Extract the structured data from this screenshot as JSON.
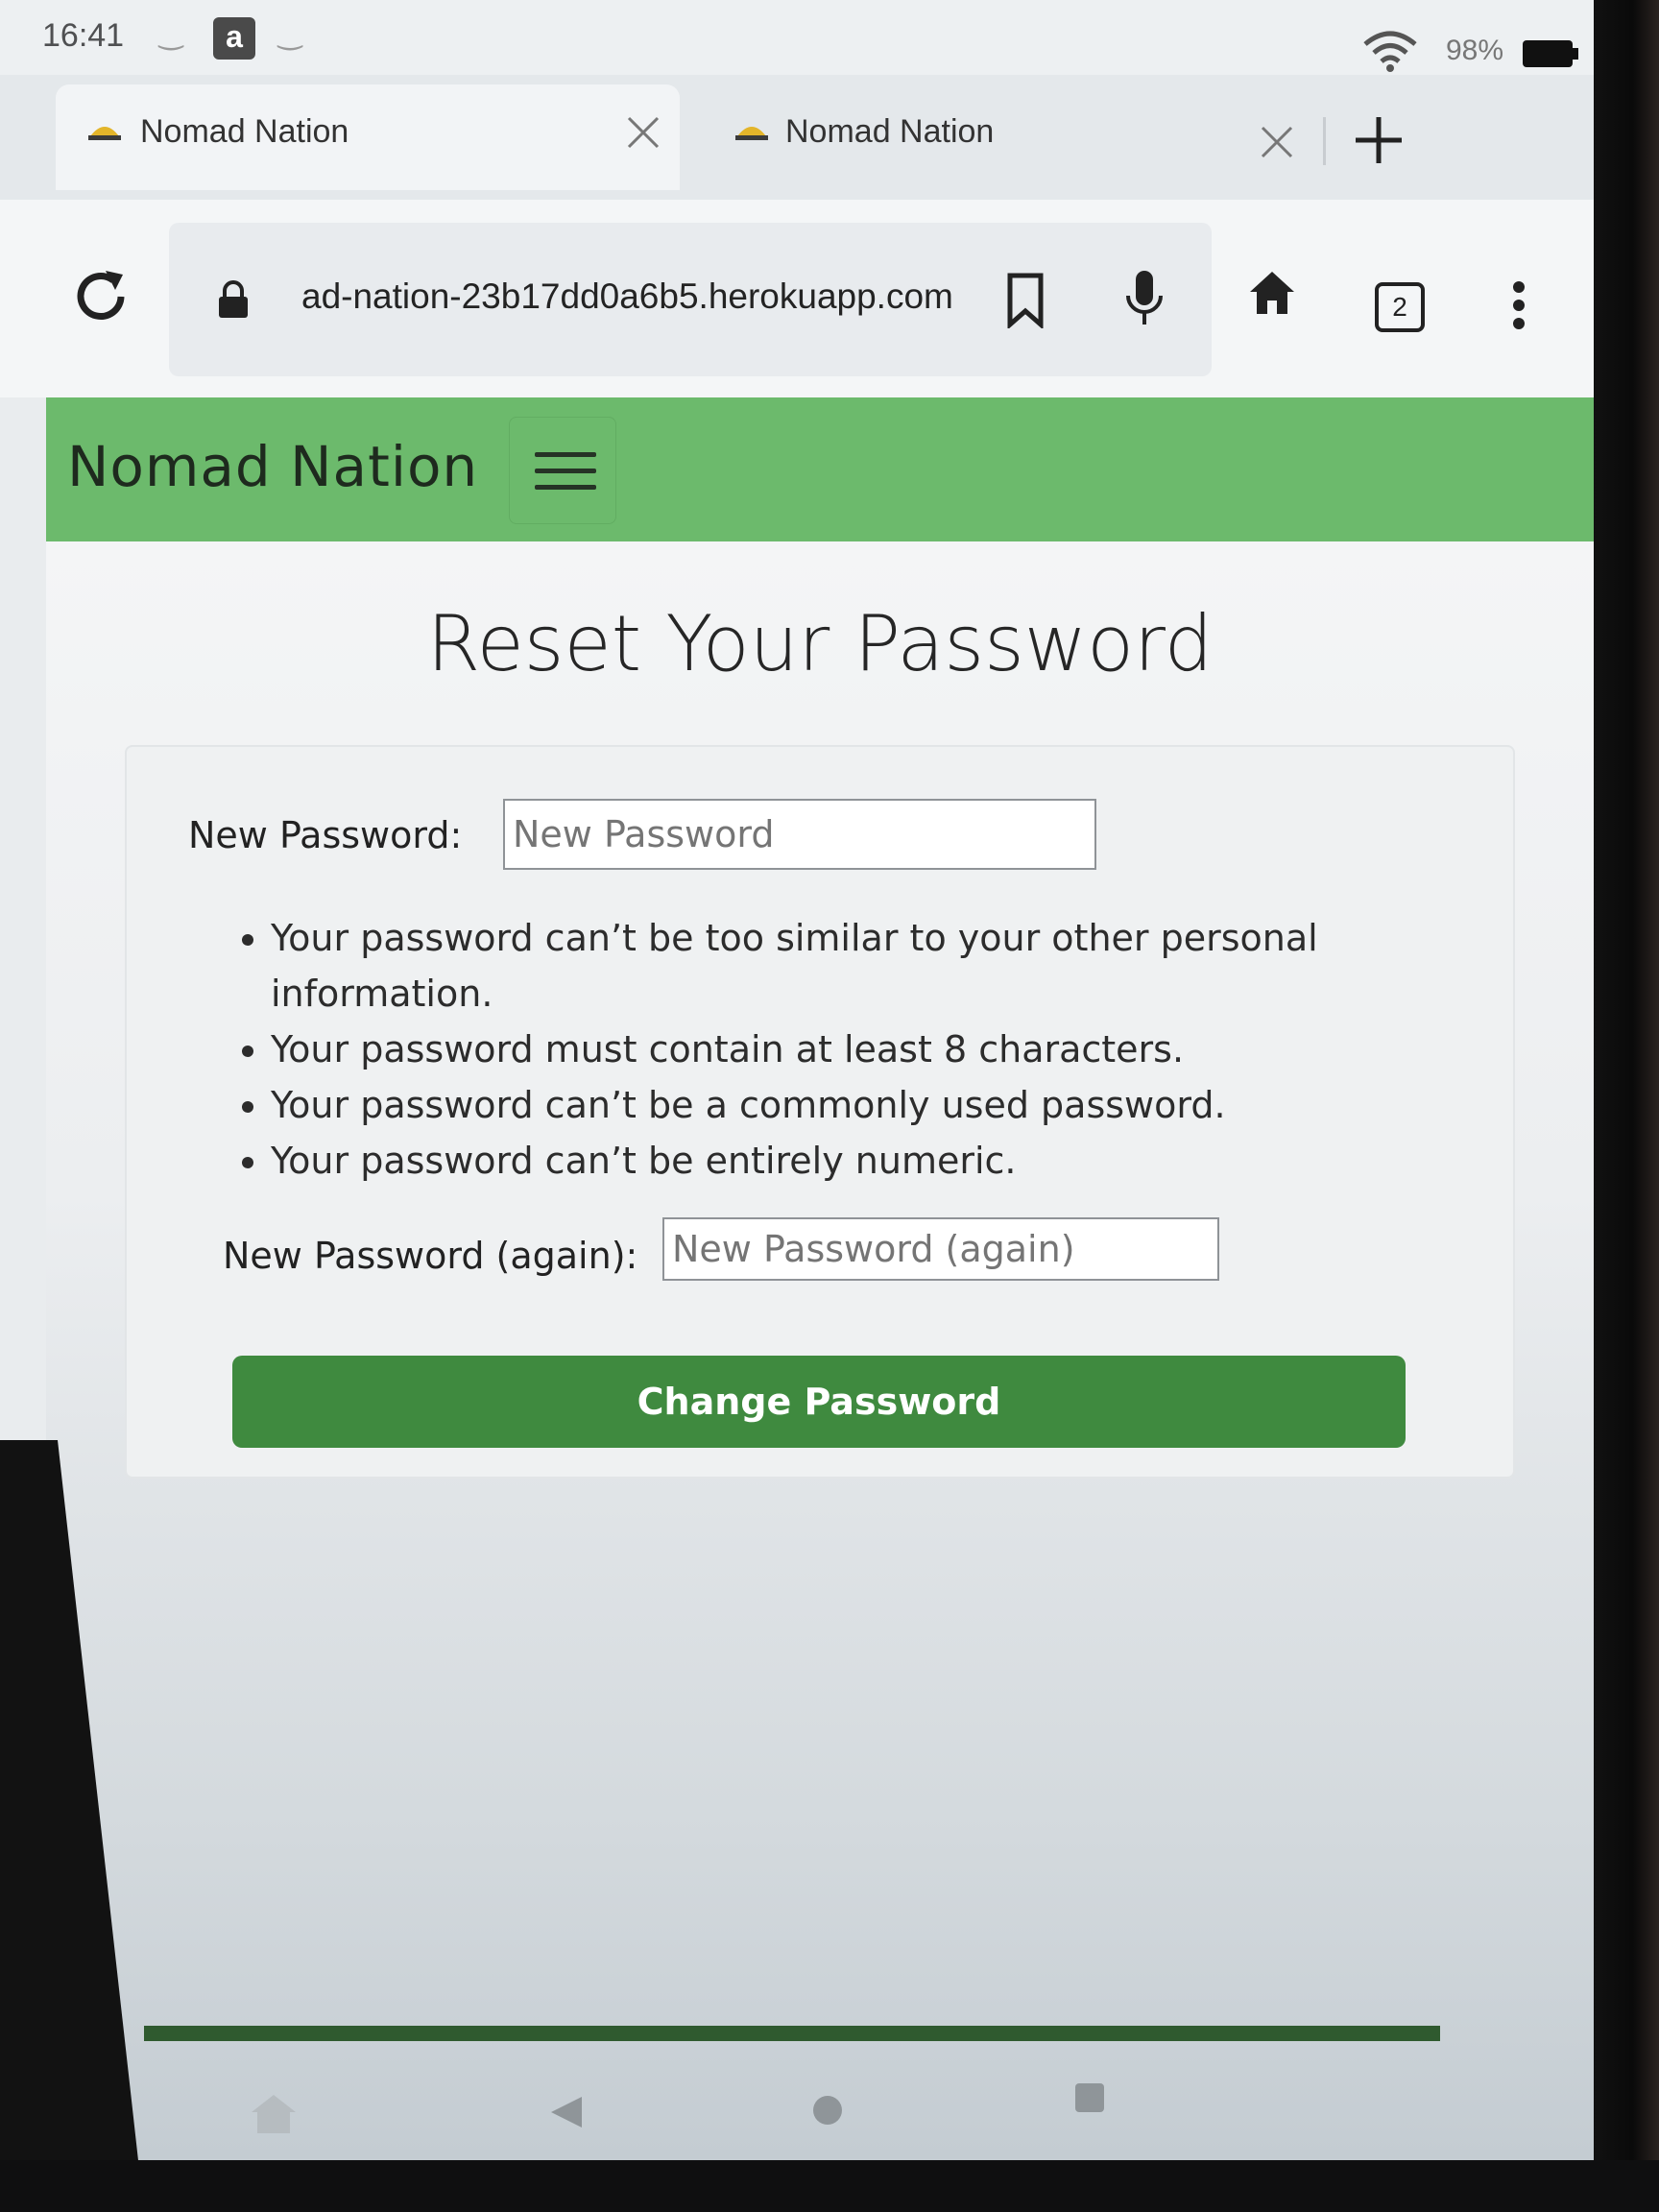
{
  "status_bar": {
    "time": "16:41",
    "amazon_glyph": "a",
    "battery_percent": "98%"
  },
  "tabs": [
    {
      "title": "Nomad Nation",
      "favicon": "nomad-logo-icon",
      "active": true
    },
    {
      "title": "Nomad Nation",
      "favicon": "nomad-logo-icon",
      "active": false
    }
  ],
  "toolbar": {
    "url": "ad-nation-23b17dd0a6b5.herokuapp.com",
    "tab_count": "2"
  },
  "site": {
    "brand": "Nomad Nation",
    "accent_color": "#6cba6c",
    "button_color": "#3f8a3f"
  },
  "form": {
    "title": "Reset Your Password",
    "new_password_label": "New Password:",
    "new_password_placeholder": "New Password",
    "help_items": [
      "Your password can’t be too similar to your other personal information.",
      "Your password must contain at least 8 characters.",
      "Your password can’t be a commonly used password.",
      "Your password can’t be entirely numeric."
    ],
    "confirm_label": "New Password (again):",
    "confirm_placeholder": "New Password (again)",
    "submit_label": "Change Password"
  }
}
